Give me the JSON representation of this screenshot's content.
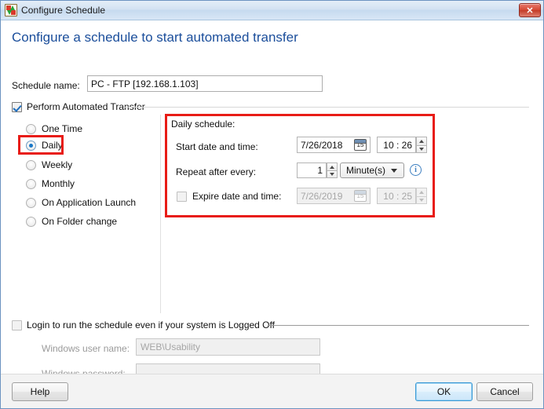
{
  "window": {
    "title": "Configure Schedule",
    "app_icon": "transfer-icon",
    "close_label": "✕"
  },
  "heading": "Configure a schedule to start automated transfer",
  "schedule_name": {
    "label": "Schedule name:",
    "value": "PC - FTP [192.168.1.103]"
  },
  "perform_group": {
    "label": "Perform Automated Transfer",
    "checked": true
  },
  "frequency_options": [
    {
      "label": "One Time",
      "selected": false
    },
    {
      "label": "Daily",
      "selected": true
    },
    {
      "label": "Weekly",
      "selected": false
    },
    {
      "label": "Monthly",
      "selected": false
    },
    {
      "label": "On Application Launch",
      "selected": false
    },
    {
      "label": "On Folder change",
      "selected": false
    }
  ],
  "daily_panel": {
    "title": "Daily schedule:",
    "start": {
      "label": "Start date and time:",
      "date": "7/26/2018",
      "time": "10 : 26",
      "calendar_day": "15"
    },
    "repeat": {
      "label": "Repeat after every:",
      "count": "1",
      "unit": "Minute(s)",
      "info_icon": "i"
    },
    "expire": {
      "label": "Expire date and time:",
      "checked": false,
      "date": "7/26/2019",
      "time": "10 : 25",
      "calendar_day": "15"
    }
  },
  "login_group": {
    "label": "Login to run the schedule even if your system is Logged Off",
    "checked": false,
    "user_name": {
      "label": "Windows user name:",
      "value": "WEB\\Usability"
    },
    "password": {
      "label": "Windows password:",
      "value": ""
    }
  },
  "footer": {
    "help": "Help",
    "ok": "OK",
    "cancel": "Cancel"
  },
  "colors": {
    "highlight": "#e81c16",
    "heading": "#1b4e9b",
    "accent": "#1978c8"
  }
}
